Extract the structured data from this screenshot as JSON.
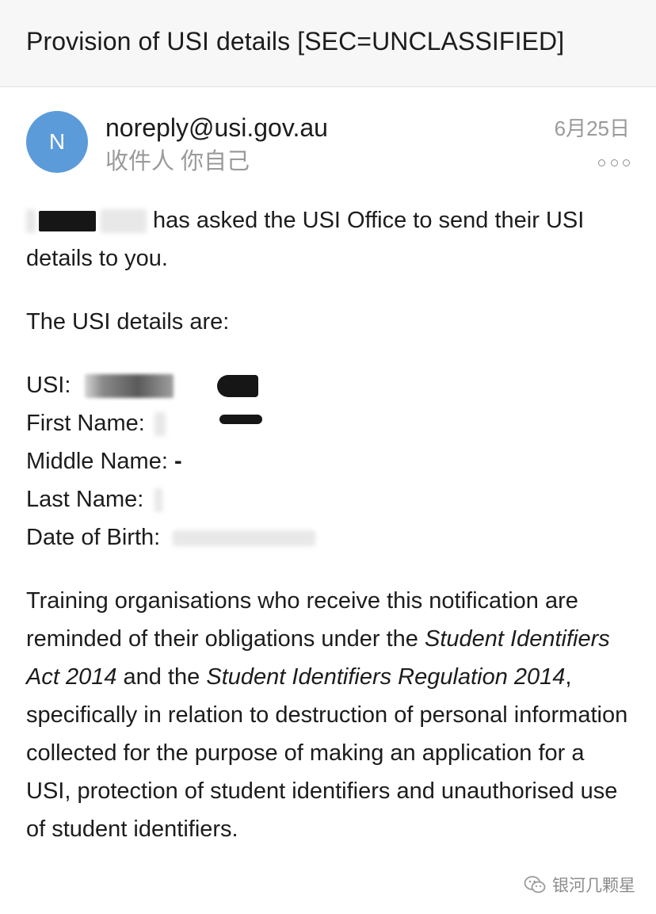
{
  "email": {
    "subject": "Provision of USI details [SEC=UNCLASSIFIED]",
    "avatar_initial": "N",
    "sender": "noreply@usi.gov.au",
    "recipient": "收件人 你自己",
    "date": "6月25日",
    "more_icon": "more-dots-icon"
  },
  "body": {
    "intro": "has asked the USI Office to send their USI details to you.",
    "details_heading": "The USI details are:",
    "fields": [
      {
        "label": "USI:",
        "value": ""
      },
      {
        "label": "First Name:",
        "value": ""
      },
      {
        "label": "Middle Name:",
        "value": "-"
      },
      {
        "label": "Last Name:",
        "value": ""
      },
      {
        "label": "Date of Birth:",
        "value": ""
      }
    ],
    "notice": {
      "part1": "Training organisations who receive this notification are reminded of their obligations under the ",
      "act": "Student Identifiers Act 2014",
      "part2": " and the ",
      "regulation": "Student Identifiers Regulation 2014",
      "part3": ", specifically in relation to destruction of personal information collected for the purpose of making an application for a USI, protection of student identifiers and unauthorised use of student identifiers."
    }
  },
  "watermark": {
    "text": "银河几颗星",
    "icon": "wechat-icon"
  }
}
